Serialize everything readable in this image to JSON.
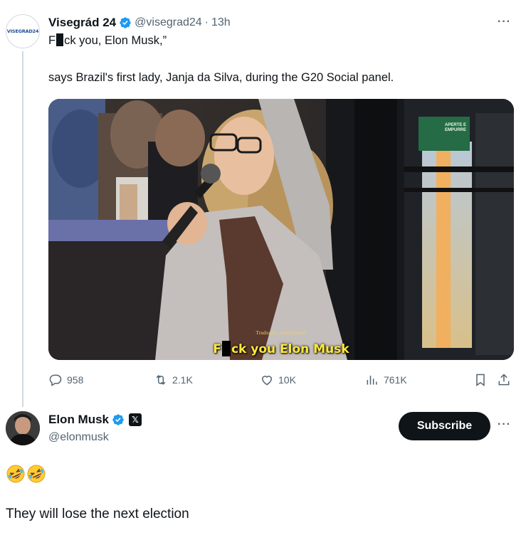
{
  "tweet1": {
    "avatar_text": "VISEGRAD24",
    "author_name": "Visegrád 24",
    "handle": "@visegrad24",
    "separator": "·",
    "time": "13h",
    "text_prefix": "F",
    "text_suffix": "ck you, Elon Musk,”",
    "text_line2": "says Brazil's first lady, Janja da Silva, during the G20 Social panel.",
    "media": {
      "subtitle_prefix": "F",
      "subtitle_suffix": "ck you Elon Musk",
      "credit": "Tradução: SamPancher",
      "sign_text": "APERTE E EMPURRE"
    },
    "stats": {
      "replies": "958",
      "reposts": "2.1K",
      "likes": "10K",
      "views": "761K"
    }
  },
  "tweet2": {
    "author_name": "Elon Musk",
    "handle": "@elonmusk",
    "subscribe_label": "Subscribe",
    "emoji": "rolling-on-floor-laughing",
    "text": "They will lose the next election"
  },
  "more_label": "···",
  "colors": {
    "verified_blue": "#1d9bf0",
    "text_primary": "#0f1419",
    "text_secondary": "#536471",
    "subtitle_yellow": "#ffe83a"
  }
}
